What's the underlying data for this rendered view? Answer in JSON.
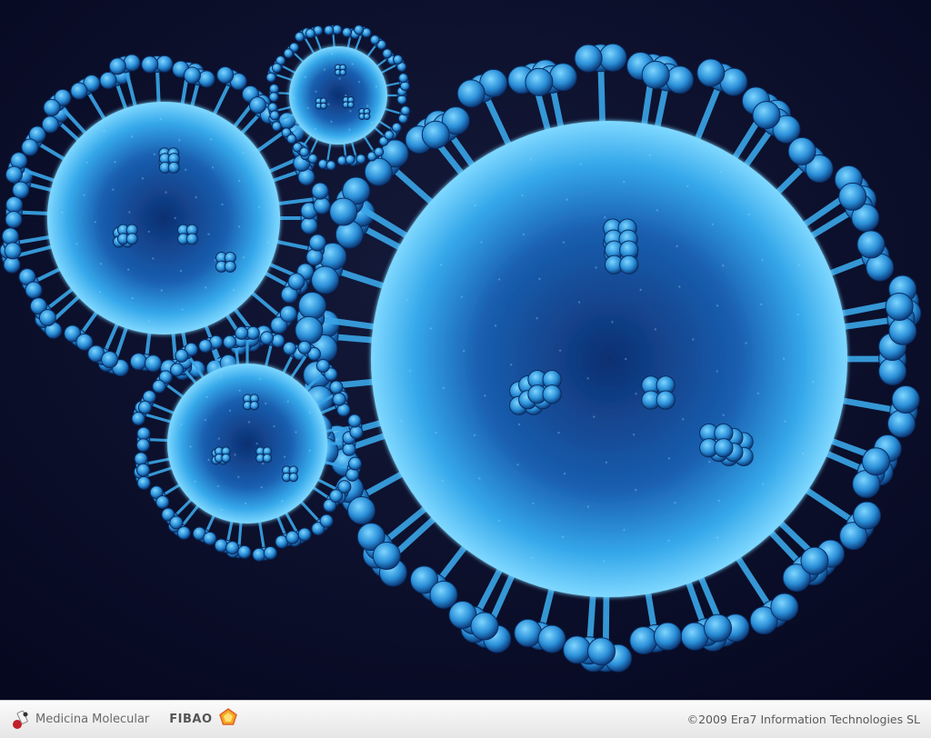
{
  "footer": {
    "left_label": "Medicina Molecular",
    "middle_label": "FIBAO",
    "copyright": "©2009 Era7 Information Technologies SL"
  },
  "icons": {
    "left_logo": "medicina-molecular-logo",
    "middle_logo": "fibao-pentagon-logo"
  },
  "colors": {
    "background": "#0a0d24",
    "virus": "#3fb7f2",
    "virus_dark": "#0b2a66",
    "footer_bg": "#ececec"
  }
}
